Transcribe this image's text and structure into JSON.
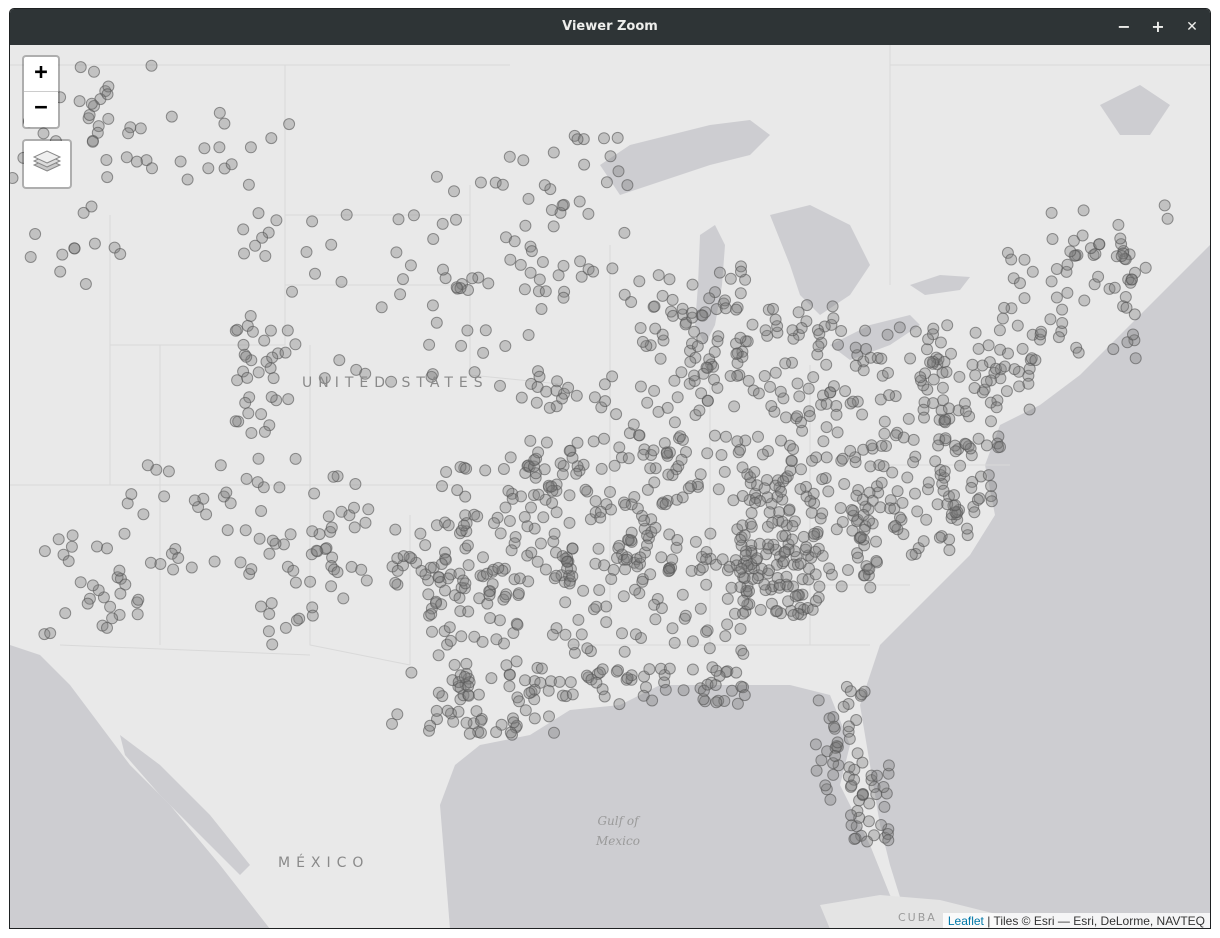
{
  "window": {
    "title": "Viewer Zoom",
    "minimize_glyph": "−",
    "maximize_glyph": "+",
    "close_glyph": "✕"
  },
  "map": {
    "zoom_in_label": "+",
    "zoom_out_label": "−",
    "layers_icon": "layers-icon",
    "labels": {
      "country_us": "UNITED STATES",
      "country_mx": "MÉXICO",
      "gulf_line1": "Gulf of",
      "gulf_line2": "Mexico",
      "cuba": "CUBA"
    },
    "attribution": {
      "link_text": "Leaflet",
      "rest_text": " | Tiles © Esri — Esri, DeLorme, NAVTEQ"
    },
    "colors": {
      "land": "#e9e9e9",
      "water": "#cdcdd1",
      "marker_fill": "#7a7a7a",
      "marker_stroke": "#555555"
    }
  }
}
